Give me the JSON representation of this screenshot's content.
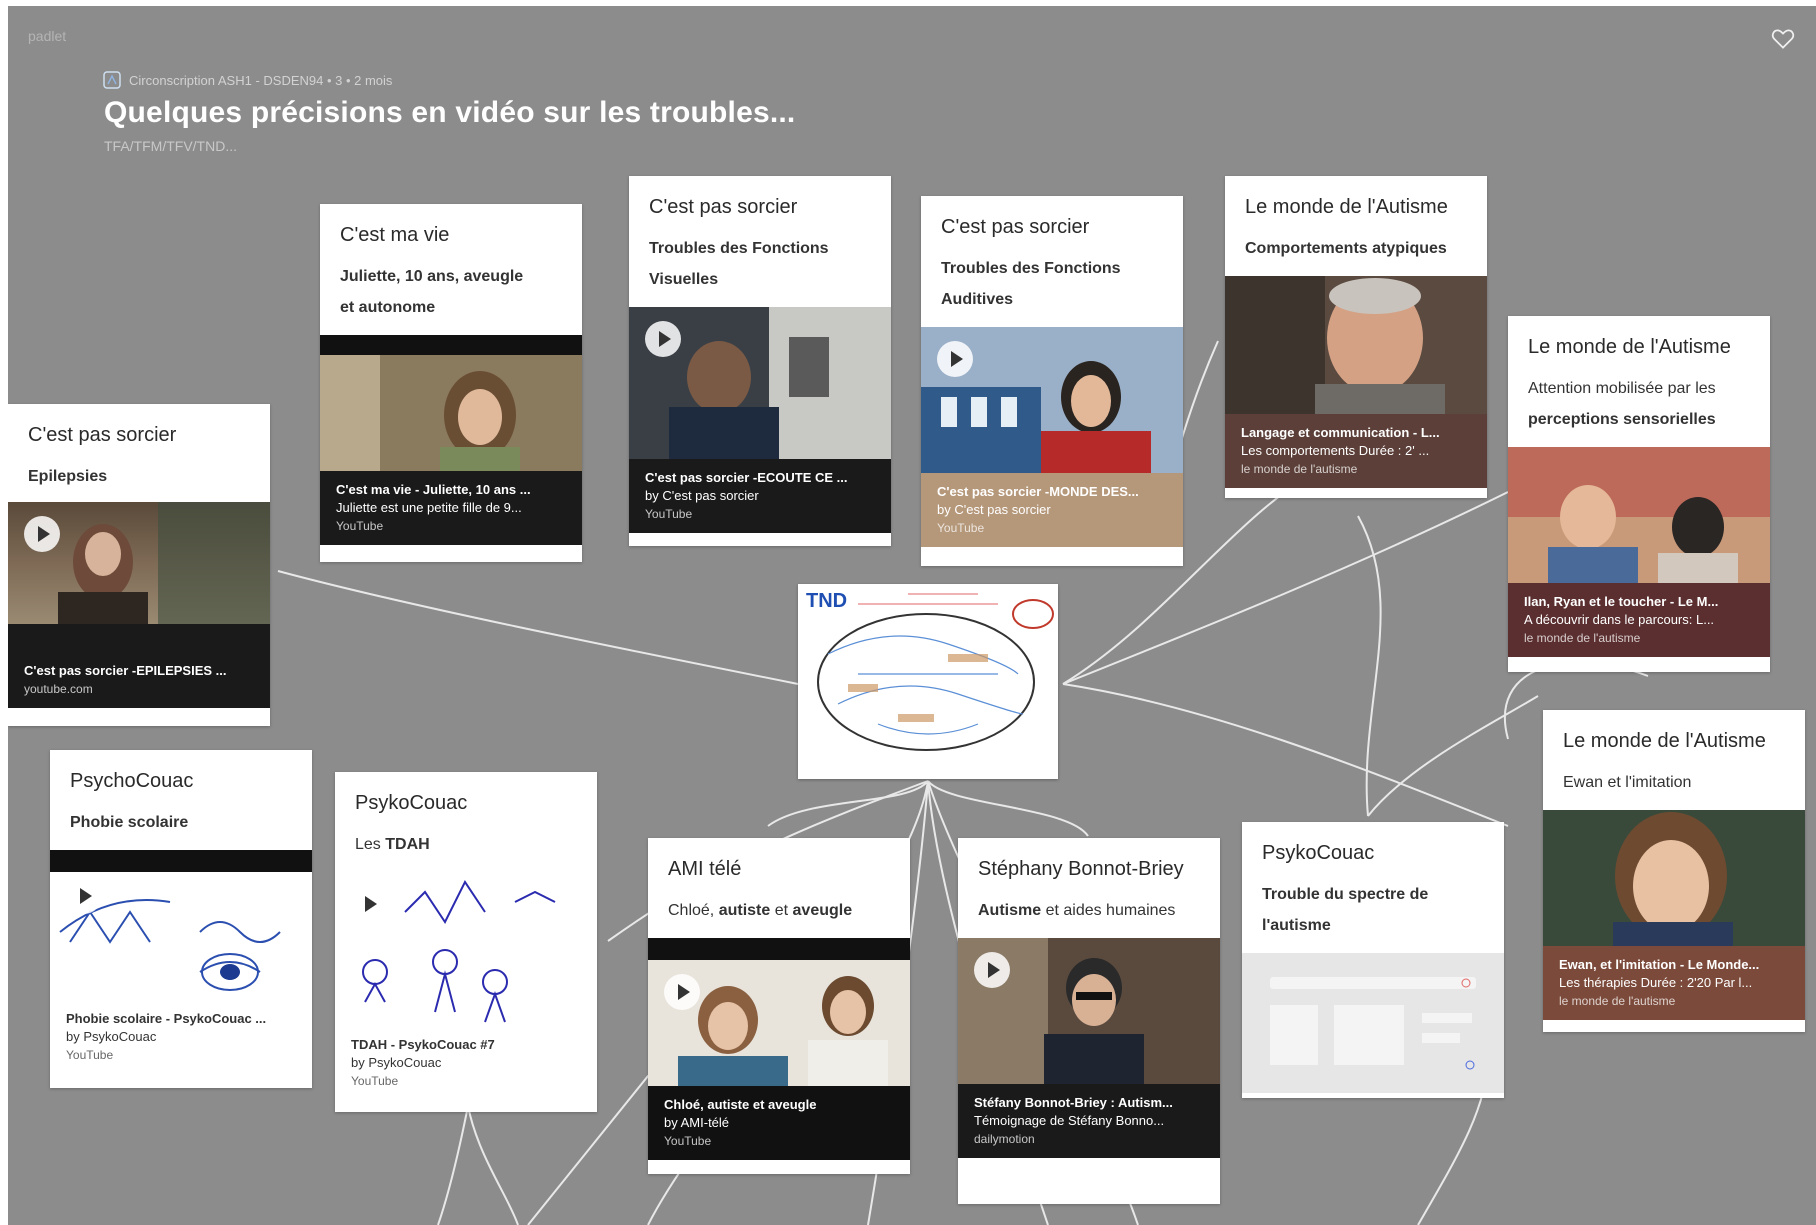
{
  "app": {
    "logo": "padlet"
  },
  "header": {
    "meta": "Circonscription ASH1 - DSDEN94  •  3  •  2 mois",
    "title": "Quelques précisions en vidéo sur les troubles...",
    "subtitle": "TFA/TFM/TFV/TND..."
  },
  "diagram": {
    "label": "TND"
  },
  "posts": [
    {
      "id": "epilepsies",
      "title": "C'est pas sorcier",
      "subtitle": "Epilepsies",
      "subtitle_bold": true,
      "link_title": "C'est pas sorcier -EPILEPSIES ...",
      "link_desc": "",
      "link_source": "youtube.com",
      "footer_color": "#1a1a1a"
    },
    {
      "id": "juliette",
      "title": "C'est ma vie",
      "subtitle": "Juliette, 10 ans, aveugle et autonome",
      "subtitle_bold": true,
      "link_title": "C'est ma vie - Juliette, 10 ans ...",
      "link_desc": "Juliette est une petite fille de 9...",
      "link_source": "YouTube",
      "footer_color": "#1a1a1a"
    },
    {
      "id": "visuelles",
      "title": "C'est pas sorcier",
      "subtitle": "Troubles des Fonctions Visuelles",
      "subtitle_bold": true,
      "link_title": "C'est pas sorcier -ECOUTE CE ...",
      "link_desc": "by C'est pas sorcier",
      "link_source": "YouTube",
      "footer_color": "#1a1a1a"
    },
    {
      "id": "auditives",
      "title": "C'est pas sorcier",
      "subtitle": "Troubles des Fonctions Auditives",
      "subtitle_bold": true,
      "link_title": "C'est pas sorcier -MONDE DES...",
      "link_desc": "by C'est pas sorcier",
      "link_source": "YouTube",
      "footer_color": "#b5977a"
    },
    {
      "id": "atypiques",
      "title": "Le monde de l'Autisme",
      "subtitle": "Comportements atypiques",
      "subtitle_bold": true,
      "link_title": "Langage et communication - L...",
      "link_desc": "Les comportements Durée : 2' ...",
      "link_source": "le monde de l'autisme",
      "footer_color": "#5b3f38"
    },
    {
      "id": "sensorielles",
      "title": "Le monde de l'Autisme",
      "subtitle_plain": "Attention mobilisée par les",
      "subtitle_bold_part": "perceptions sensorielles",
      "link_title": "Ilan, Ryan et le toucher - Le M...",
      "link_desc": "A découvrir dans le parcours: L...",
      "link_source": "le monde de l'autisme",
      "footer_color": "#5b2f30"
    },
    {
      "id": "imitation",
      "title": "Le monde de l'Autisme",
      "subtitle": "Ewan et l'imitation",
      "subtitle_bold": false,
      "link_title": "Ewan, et l'imitation - Le Monde...",
      "link_desc": "Les thérapies Durée : 2'20 Par l...",
      "link_source": "le monde de l'autisme",
      "footer_color": "#7b4a3a"
    },
    {
      "id": "phobie",
      "title": "PsychoCouac",
      "subtitle": "Phobie scolaire",
      "subtitle_bold": true,
      "link_title": "Phobie scolaire - PsykoCouac ...",
      "link_desc": "by PsykoCouac",
      "link_source": "YouTube",
      "footer_color": "#ffffff"
    },
    {
      "id": "tdah",
      "title": "PsykoCouac",
      "subtitle_plain": "Les ",
      "subtitle_bold_part": "TDAH",
      "link_title": "TDAH - PsykoCouac #7",
      "link_desc": "by PsykoCouac",
      "link_source": "YouTube",
      "footer_color": "#ffffff"
    },
    {
      "id": "chloe",
      "title": "AMI télé",
      "subtitle_rich": [
        "Chloé, ",
        "autiste",
        " et ",
        "aveugle"
      ],
      "link_title": "Chloé, autiste et aveugle",
      "link_desc": "by AMI-télé",
      "link_source": "YouTube",
      "footer_color": "#111111"
    },
    {
      "id": "stephany",
      "title": "Stéphany Bonnot-Briey",
      "subtitle_rich": [
        "",
        "Autisme",
        " et aides humaines",
        ""
      ],
      "link_title": "Stéfany Bonnot-Briey : Autism...",
      "link_desc": "Témoignage de Stéfany Bonno...",
      "link_source": "dailymotion",
      "footer_color": "#1a1a1a"
    },
    {
      "id": "spectre",
      "title": "PsykoCouac",
      "subtitle": "Trouble du spectre de l'autisme",
      "subtitle_bold": true,
      "link_title": "",
      "link_desc": "",
      "link_source": "",
      "footer_color": "#e6e6e6"
    }
  ],
  "colors": {
    "background": "#8c8c8c",
    "link_line": "#f0f0f0"
  }
}
